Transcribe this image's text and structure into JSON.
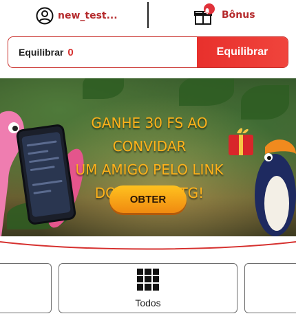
{
  "header": {
    "username": "new_test...",
    "bonus_label": "Bônus"
  },
  "balance": {
    "label": "Equilibrar",
    "value": "0",
    "button_label": "Equilibrar"
  },
  "banner": {
    "lines": [
      "GANHE 30 FS AO CONVIDAR",
      "UM AMIGO PELO LINK",
      "DO BOT DO TG!"
    ],
    "cta_label": "OBTER"
  },
  "categories": {
    "active_label": "Todos"
  },
  "colors": {
    "brand_red": "#d6312f",
    "cta_orange": "#f5a21a"
  }
}
